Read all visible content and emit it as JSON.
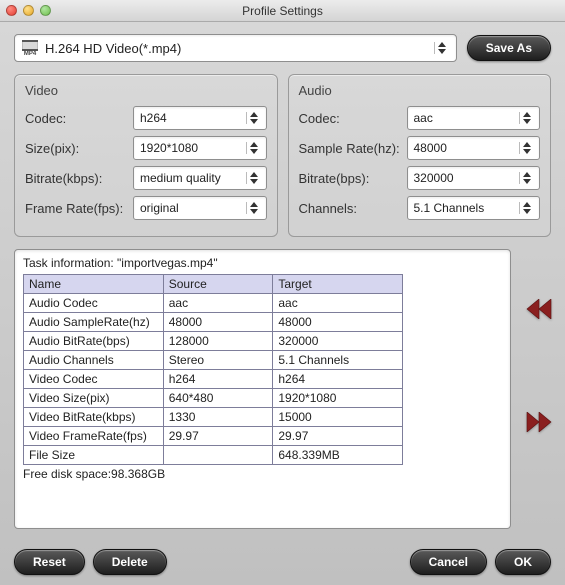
{
  "window": {
    "title": "Profile Settings"
  },
  "topbar": {
    "profile_name": "H.264 HD Video(*.mp4)",
    "save_as_label": "Save As"
  },
  "video": {
    "title": "Video",
    "codec_label": "Codec:",
    "codec_value": "h264",
    "size_label": "Size(pix):",
    "size_value": "1920*1080",
    "bitrate_label": "Bitrate(kbps):",
    "bitrate_value": "medium quality",
    "framerate_label": "Frame Rate(fps):",
    "framerate_value": "original"
  },
  "audio": {
    "title": "Audio",
    "codec_label": "Codec:",
    "codec_value": "aac",
    "samplerate_label": "Sample Rate(hz):",
    "samplerate_value": "48000",
    "bitrate_label": "Bitrate(bps):",
    "bitrate_value": "320000",
    "channels_label": "Channels:",
    "channels_value": "5.1 Channels"
  },
  "task": {
    "heading": "Task information: \"importvegas.mp4\"",
    "columns": {
      "name": "Name",
      "source": "Source",
      "target": "Target"
    },
    "rows": [
      {
        "name": "Audio Codec",
        "source": "aac",
        "target": "aac"
      },
      {
        "name": "Audio SampleRate(hz)",
        "source": "48000",
        "target": "48000"
      },
      {
        "name": "Audio BitRate(bps)",
        "source": "128000",
        "target": "320000"
      },
      {
        "name": "Audio Channels",
        "source": "Stereo",
        "target": "5.1 Channels"
      },
      {
        "name": "Video Codec",
        "source": "h264",
        "target": "h264"
      },
      {
        "name": "Video Size(pix)",
        "source": "640*480",
        "target": "1920*1080"
      },
      {
        "name": "Video BitRate(kbps)",
        "source": "1330",
        "target": "15000"
      },
      {
        "name": "Video FrameRate(fps)",
        "source": "29.97",
        "target": "29.97"
      },
      {
        "name": "File Size",
        "source": "",
        "target": "648.339MB"
      }
    ],
    "free_space": "Free disk space:98.368GB"
  },
  "buttons": {
    "reset": "Reset",
    "delete": "Delete",
    "cancel": "Cancel",
    "ok": "OK"
  }
}
